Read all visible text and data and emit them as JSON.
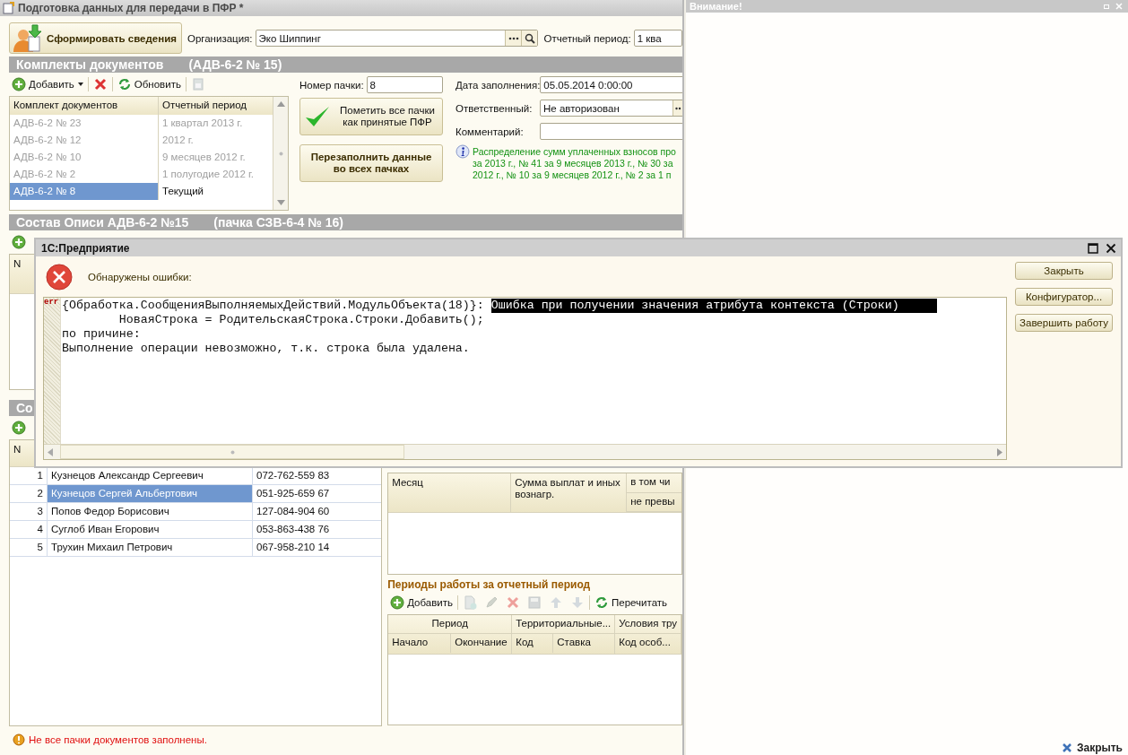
{
  "main_window": {
    "title": "Подготовка данных для передачи в ПФР *"
  },
  "header": {
    "generate_button": "Сформировать сведения",
    "organization": {
      "label": "Организация:",
      "value": "Эко Шиппинг"
    },
    "period": {
      "label": "Отчетный период:",
      "value": "1 ква"
    }
  },
  "document_sets": {
    "title": "Комплекты документов",
    "subtitle": "(АДВ-6-2 № 15)",
    "toolbar": [
      {
        "kind": "add-menu",
        "label": "Добавить",
        "disabled": false
      },
      {
        "kind": "delete",
        "disabled": false
      },
      {
        "kind": "refresh",
        "label": "Обновить",
        "disabled": false
      },
      {
        "kind": "archive",
        "disabled": true
      }
    ],
    "columns": [
      "Комплект документов",
      "Отчетный период"
    ],
    "rows": [
      {
        "cells": [
          "АДВ-6-2 № 23",
          "1 квартал 2013 г."
        ],
        "dimmed": true,
        "selected": false
      },
      {
        "cells": [
          "АДВ-6-2 № 12",
          "2012 г."
        ],
        "dimmed": true,
        "selected": false
      },
      {
        "cells": [
          "АДВ-6-2 № 10",
          "9 месяцев 2012 г."
        ],
        "dimmed": true,
        "selected": false
      },
      {
        "cells": [
          "АДВ-6-2 № 2",
          "1 полугодие 2012 г."
        ],
        "dimmed": true,
        "selected": false
      },
      {
        "cells": [
          "АДВ-6-2 № 8",
          "Текущий"
        ],
        "dimmed": false,
        "selected": true
      }
    ]
  },
  "pack": {
    "number": {
      "label": "Номер пачки:",
      "value": "8"
    },
    "mark_button": "Пометить все пачки как принятые ПФР",
    "refill_button": "Перезаполнить данные во всех пачках"
  },
  "details": {
    "fill_date": {
      "label": "Дата заполнения:",
      "value": "05.05.2014  0:00:00"
    },
    "responsible": {
      "label": "Ответственный:",
      "value": "Не авторизован"
    },
    "comment": {
      "label": "Комментарий:"
    },
    "info_lines": [
      "Распределение сумм уплаченных взносов про",
      "за 2013 г., № 41 за 9 месяцев 2013 г., № 30 за",
      "2012 г., № 10 за 9 месяцев 2012 г., № 2 за 1 п"
    ]
  },
  "inventory": {
    "title": "Состав Описи АДВ-6-2 №15",
    "subtitle": "(пачка СЗВ-6-4 № 16)",
    "toolbar": [
      {
        "kind": "add",
        "disabled": false
      }
    ],
    "columns": [
      "N"
    ]
  },
  "section_3": {
    "title": "Со"
  },
  "employees": {
    "toolbar": [
      {
        "kind": "add",
        "disabled": false
      }
    ],
    "columns": [
      "N"
    ],
    "rows": [
      {
        "n": "1",
        "name": "Кузнецов Александр Сергеевич",
        "snils": "072-762-559 83",
        "selected": false
      },
      {
        "n": "2",
        "name": "Кузнецов Сергей Альбертович",
        "snils": "051-925-659 67",
        "selected": true
      },
      {
        "n": "3",
        "name": "Попов Федор Борисович",
        "snils": "127-084-904 60",
        "selected": false
      },
      {
        "n": "4",
        "name": "Суглоб Иван Егорович",
        "snils": "053-863-438 76",
        "selected": false
      },
      {
        "n": "5",
        "name": "Трухин Михаил Петрович",
        "snils": "067-958-210 14",
        "selected": false
      }
    ]
  },
  "payments": {
    "columns": [
      "Месяц",
      "Сумма выплат и иных вознагр."
    ],
    "column_3": {
      "label": "в том чи",
      "sub_label": "не превы"
    }
  },
  "work_periods": {
    "title": "Периоды работы за отчетный период",
    "toolbar": [
      {
        "kind": "add",
        "label": "Добавить",
        "disabled": false
      },
      {
        "kind": "copy",
        "disabled": true
      },
      {
        "kind": "edit",
        "disabled": true
      },
      {
        "kind": "delete",
        "disabled": true
      },
      {
        "kind": "save",
        "disabled": true
      },
      {
        "kind": "up",
        "disabled": true
      },
      {
        "kind": "down",
        "disabled": true
      },
      {
        "kind": "refresh",
        "label": "Перечитать",
        "disabled": false
      }
    ],
    "groups": [
      {
        "label": "Период",
        "columns": [
          "Начало",
          "Окончание"
        ]
      },
      {
        "label": "Территориальные...",
        "columns": [
          "Код",
          "Ставка"
        ]
      },
      {
        "label": "Условия тру",
        "columns": [
          "Код особ..."
        ]
      }
    ]
  },
  "status": "Не все пачки документов заполнены.",
  "attention_panel": {
    "title": "Внимание!",
    "close_link": "Закрыть"
  },
  "dialog": {
    "title": "1С:Предприятие",
    "heading": "Обнаружены ошибки:",
    "gutter_mark": "err",
    "lines": [
      {
        "text": "{Обработка.СообщенияВыполняемыхДействий.МодульОбъекта(18)}: ",
        "selection": "Ошибка при получении значения атрибута контекста (Строки)"
      },
      {
        "text": "        НоваяСтрока = РодительскаяСтрока.Строки.Добавить();"
      },
      {
        "text": "по причине:"
      },
      {
        "text": "Выполнение операции невозможно, т.к. строка была удалена."
      }
    ],
    "buttons": [
      "Закрыть",
      "Конфигуратор...",
      "Завершить работу"
    ]
  }
}
